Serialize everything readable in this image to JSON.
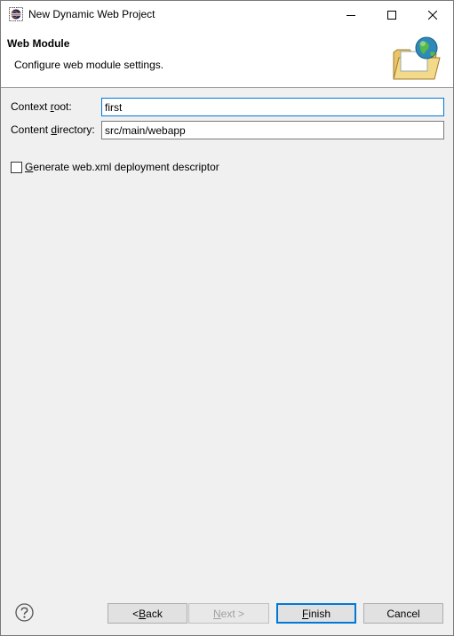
{
  "window": {
    "title": "New Dynamic Web Project"
  },
  "banner": {
    "title": "Web Module",
    "description": "Configure web module settings.",
    "icon": "web-project-folder-globe-icon"
  },
  "form": {
    "context_root": {
      "label_pre": "Context ",
      "label_mnemonic": "r",
      "label_post": "oot:",
      "value": "first"
    },
    "content_directory": {
      "label_pre": "Content ",
      "label_mnemonic": "d",
      "label_post": "irectory:",
      "value": "src/main/webapp"
    },
    "generate_webxml": {
      "label_mnemonic": "G",
      "label_post": "enerate web.xml deployment descriptor",
      "checked": false
    }
  },
  "buttons": {
    "back": {
      "pre": "< ",
      "mnemonic": "B",
      "post": "ack"
    },
    "next": {
      "mnemonic": "N",
      "post": "ext >"
    },
    "finish": {
      "mnemonic": "F",
      "post": "inish"
    },
    "cancel": {
      "label": "Cancel"
    }
  },
  "colors": {
    "accent": "#0078d7",
    "disabled_text": "#a0a0a0"
  }
}
